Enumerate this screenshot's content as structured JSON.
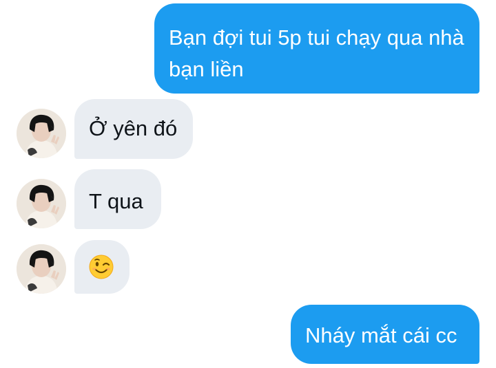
{
  "messages": [
    {
      "direction": "outgoing",
      "text": "Bạn đợi tui 5p tui chạy qua nhà bạn liền"
    },
    {
      "direction": "incoming",
      "text": "Ở yên đó"
    },
    {
      "direction": "incoming",
      "text": "T qua"
    },
    {
      "direction": "incoming",
      "emoji": "wink-emoji"
    },
    {
      "direction": "outgoing",
      "text": "Nháy mắt cái cc"
    }
  ],
  "colors": {
    "outgoing_bubble": "#1c9cf0",
    "incoming_bubble": "#e9edf2",
    "incoming_text": "#0f1419",
    "outgoing_text": "#ffffff"
  }
}
